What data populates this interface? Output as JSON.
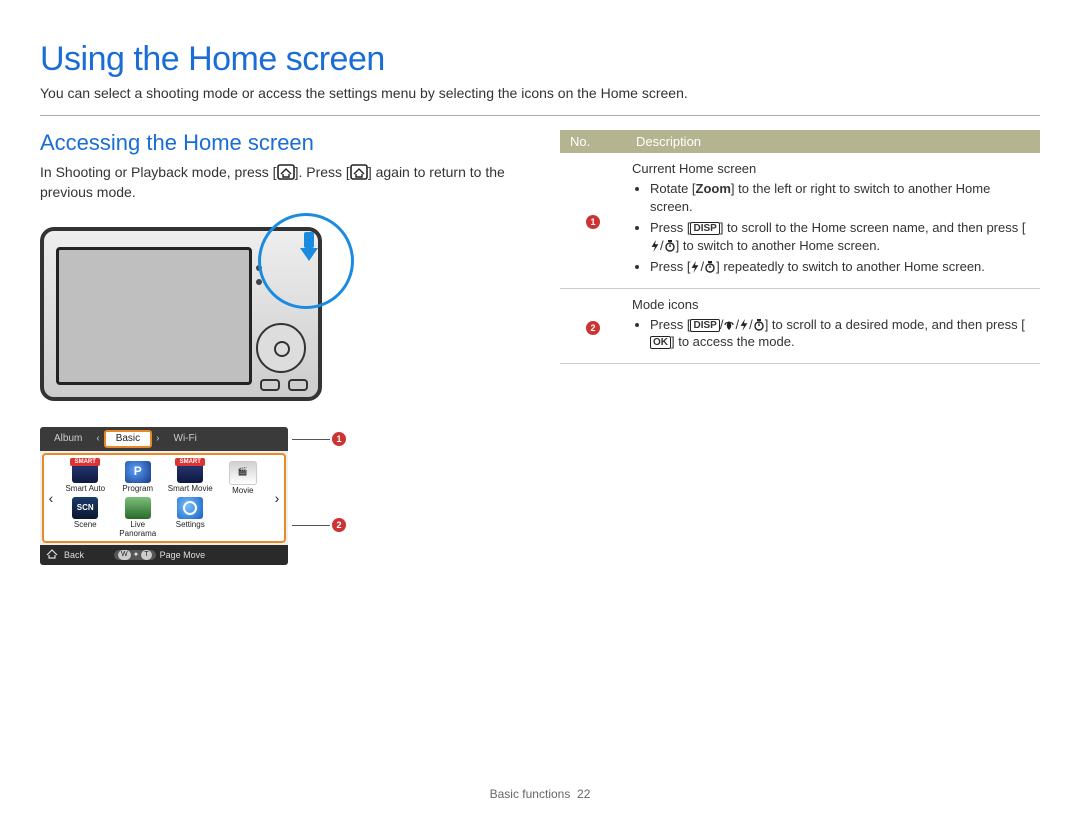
{
  "title": "Using the Home screen",
  "intro": "You can select a shooting mode or access the settings menu by selecting the icons on the Home screen.",
  "section_heading": "Accessing the Home screen",
  "body_leading": "In Shooting or Playback mode, press [",
  "body_mid": "]. Press [",
  "body_trail": "] again to return to the previous mode.",
  "tabs": {
    "left": "Album",
    "center": "Basic",
    "right": "Wi-Fi"
  },
  "icons": [
    {
      "label": "Smart Auto",
      "cls": "ic-smart"
    },
    {
      "label": "Program",
      "cls": "ic-prog"
    },
    {
      "label": "Smart Movie",
      "cls": "ic-smart"
    },
    {
      "label": "Movie",
      "cls": "ic-movie"
    },
    {
      "label": "Scene",
      "cls": "ic-scene"
    },
    {
      "label": "Live Panorama",
      "cls": "ic-pano"
    },
    {
      "label": "Settings",
      "cls": "ic-set"
    }
  ],
  "footer": {
    "back": "Back",
    "pagemove": "Page Move"
  },
  "callouts": {
    "one": "1",
    "two": "2"
  },
  "table": {
    "head_no": "No.",
    "head_desc": "Description",
    "rows": [
      {
        "num": "1",
        "title": "Current Home screen",
        "items": [
          {
            "pre": "Rotate [",
            "glyph": "zoom",
            "mid": "] to the left or right to switch to another Home screen."
          },
          {
            "pre": "Press [",
            "glyph": "disp",
            "mid": "] to scroll to the Home screen name, and then press [",
            "glyph2": "flash-timer",
            "mid2": "] to switch to another Home screen."
          },
          {
            "pre": "Press [",
            "glyph": "flash-timer",
            "mid": "] repeatedly to switch to another Home screen."
          }
        ]
      },
      {
        "num": "2",
        "title": "Mode icons",
        "items": [
          {
            "pre": "Press [",
            "glyph": "all4",
            "mid": "] to scroll to a desired mode, and then press [",
            "glyph2": "ok",
            "mid2": "] to access the mode."
          }
        ]
      }
    ]
  },
  "pagefoot_section": "Basic functions",
  "pagefoot_num": "22",
  "zoom_word": "Zoom"
}
